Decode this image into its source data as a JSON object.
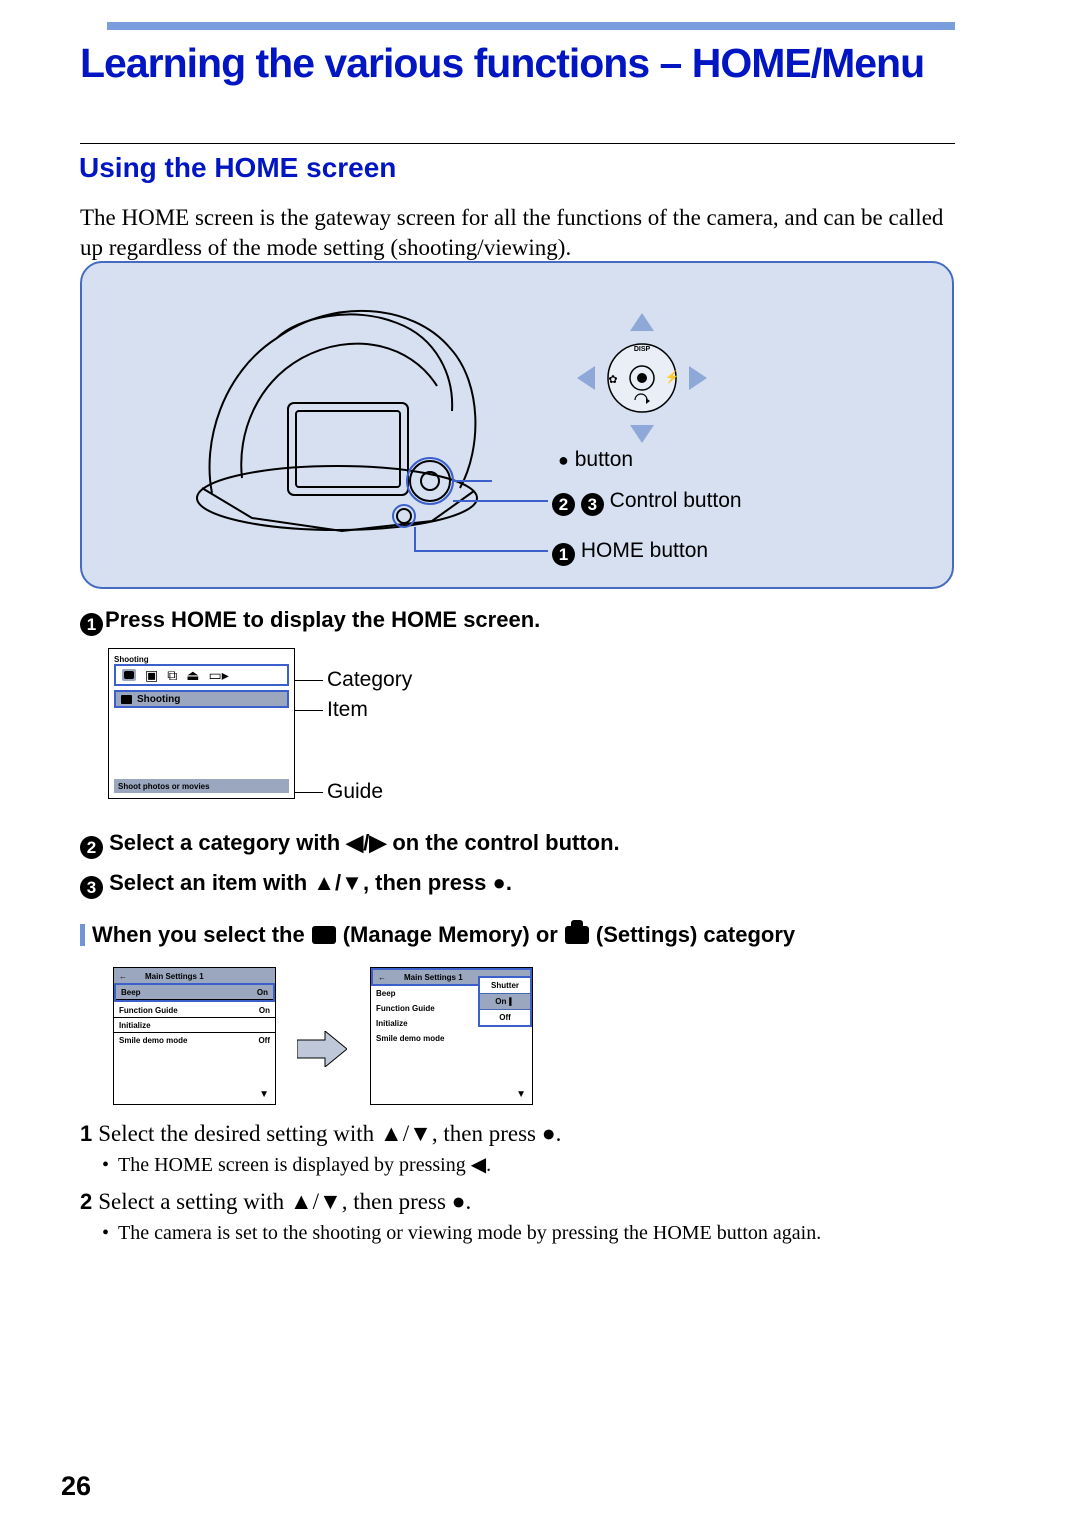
{
  "page_number": "26",
  "title": "Learning the various functions – HOME/Menu",
  "section_title": "Using the HOME screen",
  "intro": "The HOME screen is the gateway screen for all the functions of the camera, and can be called up regardless of the mode setting (shooting/viewing).",
  "panel": {
    "label_button": " button",
    "label_control": " Control button",
    "label_home": " HOME button",
    "pad_disp": "DISP"
  },
  "steps": {
    "s1": "Press HOME to display the HOME screen.",
    "s2": " Select a category with ◀/▶ on the control button.",
    "s3": " Select an item with ▲/▼, then press ●."
  },
  "home_lcd": {
    "top": "Shooting",
    "item": "Shooting",
    "guide": "Shoot photos or movies"
  },
  "home_labels": {
    "category": "Category",
    "item": "Item",
    "guide": "Guide"
  },
  "subheading": {
    "pre": "When you select the ",
    "mid": " (Manage Memory) or ",
    "post": " (Settings) category"
  },
  "settings": {
    "header_back": "←",
    "header_title": "Main Settings 1",
    "rows": [
      {
        "k": "Beep",
        "v": "On"
      },
      {
        "k": "Function Guide",
        "v": "On"
      },
      {
        "k": "Initialize",
        "v": ""
      },
      {
        "k": "Smile demo mode",
        "v": "Off"
      }
    ],
    "options": {
      "shutter": "Shutter",
      "on": "On",
      "off": "Off"
    },
    "right_arrow": "◀"
  },
  "sub_steps": {
    "s1_pre": "Select the desired setting with ▲/▼, then press ●.",
    "s1_bullet": "The HOME screen is displayed by pressing ◀.",
    "s2_pre": "Select a setting with ▲/▼, then press ●.",
    "s2_bullet": "The camera is set to the shooting or viewing mode by pressing the HOME button again."
  }
}
